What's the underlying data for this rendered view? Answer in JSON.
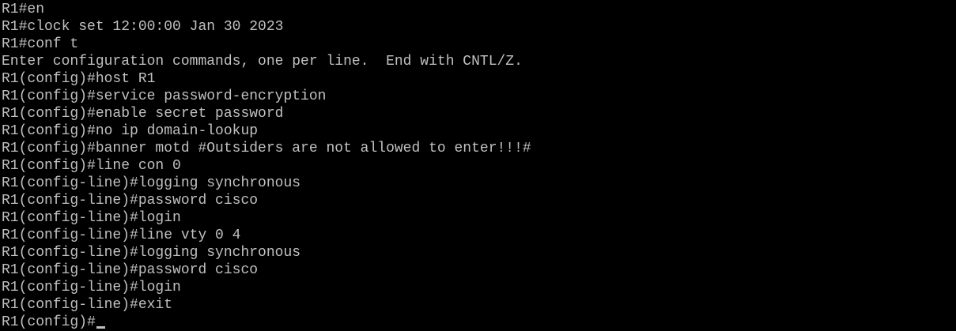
{
  "colors": {
    "background": "#000000",
    "foreground": "#c0c0c0"
  },
  "terminal": {
    "lines": [
      "R1#en",
      "R1#clock set 12:00:00 Jan 30 2023",
      "R1#conf t",
      "Enter configuration commands, one per line.  End with CNTL/Z.",
      "R1(config)#host R1",
      "R1(config)#service password-encryption",
      "R1(config)#enable secret password",
      "R1(config)#no ip domain-lookup",
      "R1(config)#banner motd #Outsiders are not allowed to enter!!!#",
      "R1(config)#line con 0",
      "R1(config-line)#logging synchronous",
      "R1(config-line)#password cisco",
      "R1(config-line)#login",
      "R1(config-line)#line vty 0 4",
      "R1(config-line)#logging synchronous",
      "R1(config-line)#password cisco",
      "R1(config-line)#login",
      "R1(config-line)#exit"
    ],
    "current_prompt": "R1(config)#"
  }
}
